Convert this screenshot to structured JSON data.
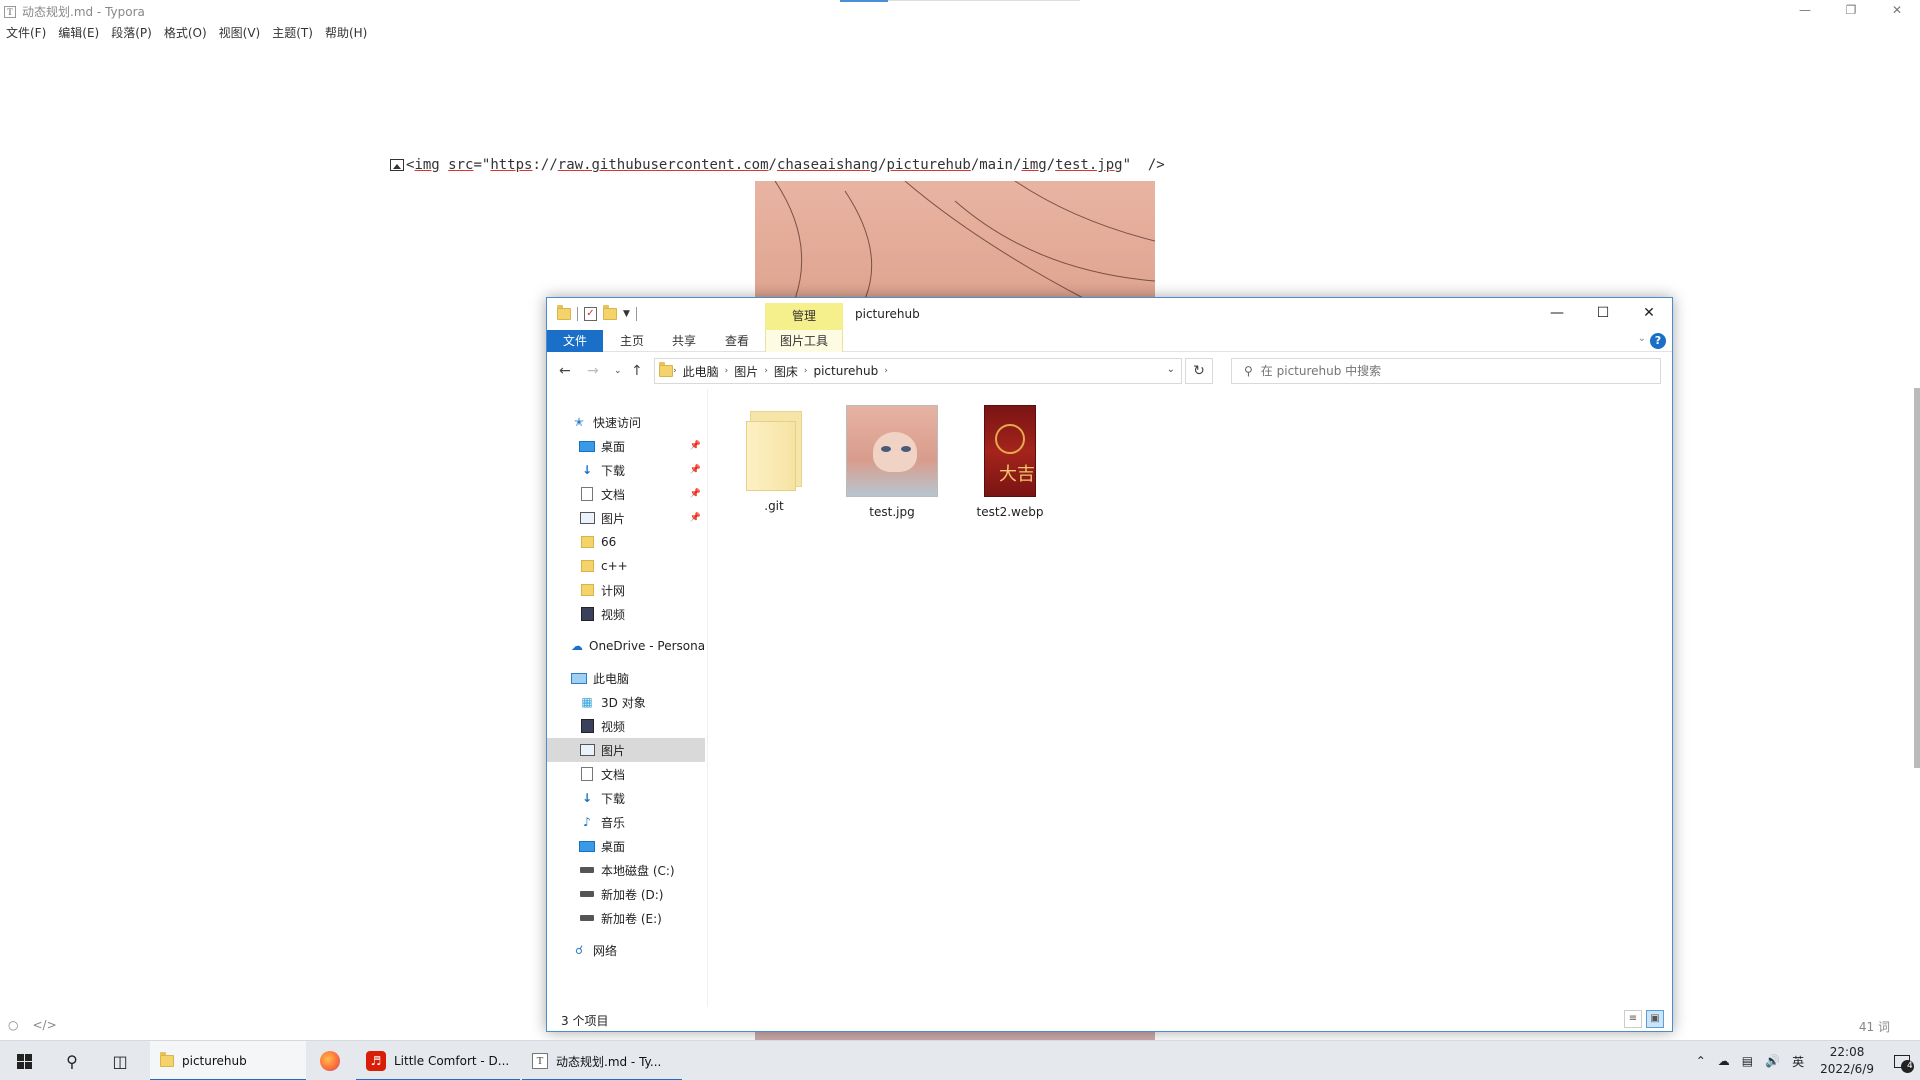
{
  "typora": {
    "window_title": "动态规划.md - Typora",
    "menu": [
      "文件(F)",
      "编辑(E)",
      "段落(P)",
      "格式(O)",
      "视图(V)",
      "主题(T)",
      "帮助(H)"
    ],
    "code_parts": {
      "open": "<",
      "tag": "img",
      "space": " ",
      "attr": "src",
      "eq": "=\"",
      "url_proto": "https",
      "sep1": "://",
      "url_host": "raw.githubusercontent.com",
      "slash1": "/",
      "url_user": "chaseaishang",
      "slash2": "/",
      "url_repo": "picturehub",
      "url_mid": "/main/",
      "url_dir": "img",
      "slash3": "/",
      "url_file": "test.jpg",
      "close": "\"  />"
    },
    "status_left_icons": [
      "circle-icon",
      "code-icon"
    ],
    "word_count": "41 词"
  },
  "explorer": {
    "title": "picturehub",
    "context_tab": "管理",
    "ribbon_tabs": {
      "file": "文件",
      "home": "主页",
      "share": "共享",
      "view": "查看",
      "picture_tools": "图片工具"
    },
    "breadcrumb": [
      "此电脑",
      "图片",
      "图床",
      "picturehub"
    ],
    "search_placeholder": "在 picturehub 中搜索",
    "sidebar": {
      "quick_access": "快速访问",
      "quick_items": [
        "桌面",
        "下载",
        "文档",
        "图片",
        "66",
        "c++",
        "计网",
        "视频"
      ],
      "onedrive": "OneDrive - Persona",
      "this_pc": "此电脑",
      "pc_items": [
        "3D 对象",
        "视频",
        "图片",
        "文档",
        "下载",
        "音乐",
        "桌面",
        "本地磁盘 (C:)",
        "新加卷 (D:)",
        "新加卷 (E:)"
      ],
      "network": "网络",
      "selected": "图片"
    },
    "files": [
      {
        "name": ".git",
        "type": "folder"
      },
      {
        "name": "test.jpg",
        "type": "image"
      },
      {
        "name": "test2.webp",
        "type": "image"
      }
    ],
    "status": "3 个项目",
    "help_label": "?"
  },
  "taskbar": {
    "apps": [
      "picturehub",
      "Little Comfort - D...",
      "动态规划.md - Ty..."
    ],
    "ime": "英",
    "time": "22:08",
    "date": "2022/6/9",
    "notifications": "4"
  }
}
